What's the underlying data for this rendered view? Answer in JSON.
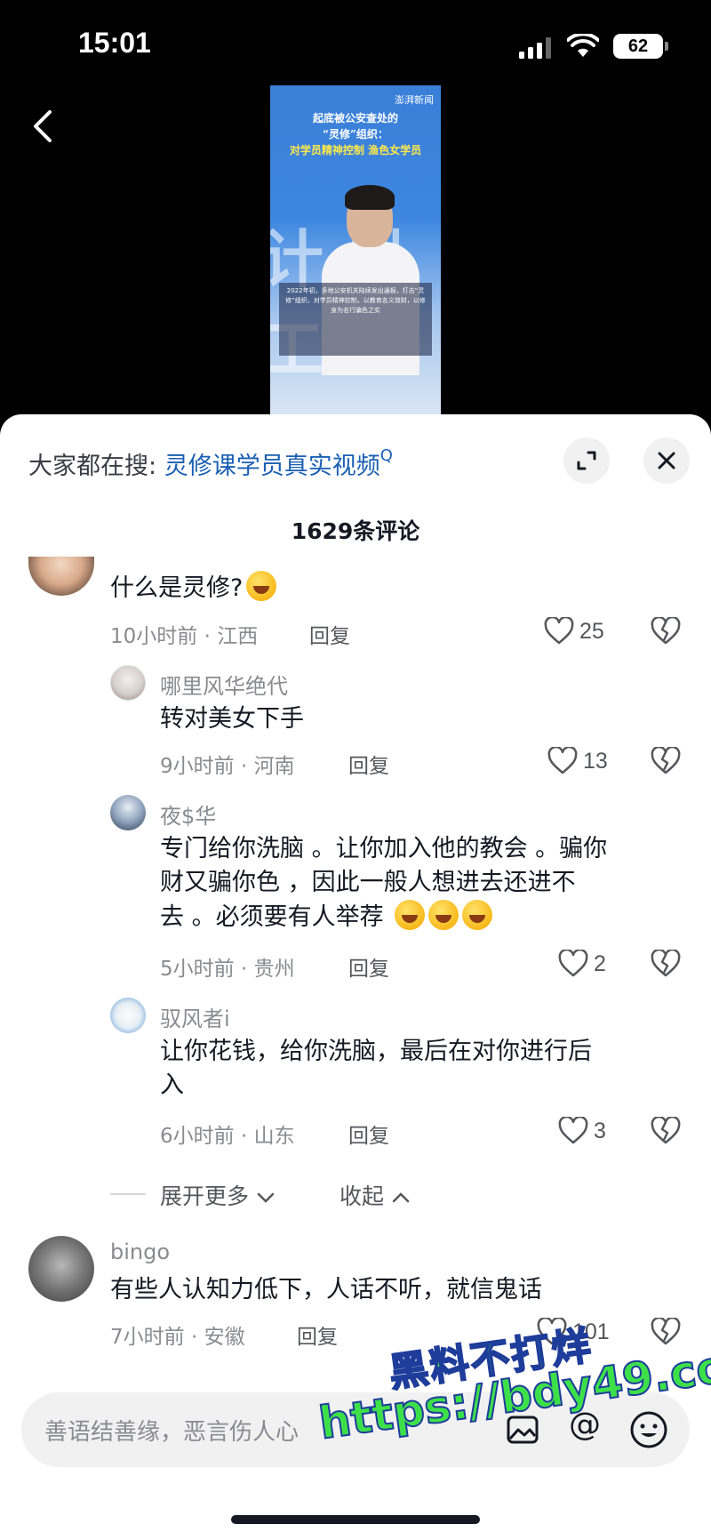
{
  "status_bar": {
    "time": "15:01",
    "battery": "62"
  },
  "video": {
    "brand": "澎湃新闻",
    "title_line1": "起底被公安查处的",
    "title_line2": "“灵修”组织：",
    "title_line3": "对学员精神控制 渔色女学员",
    "background_text": "计划工",
    "caption": "2022年初，多地公安机关陆续发出通报，打击“灵修”组织，对学员精神控制，以教育名义敛财，以修身为名行骗色之实"
  },
  "sheet": {
    "search_prefix": "大家都在搜:",
    "search_term": "灵修课学员真实视频",
    "search_q": "Q",
    "comment_count": "1629条评论"
  },
  "comments": [
    {
      "name": "",
      "text": "什么是灵修?",
      "time": "10小时前 · 江西",
      "reply": "回复",
      "likes": "25"
    },
    {
      "name": "哪里风华绝代",
      "text": "转对美女下手",
      "time": "9小时前 · 河南",
      "reply": "回复",
      "likes": "13"
    },
    {
      "name": "夜$华",
      "text_line1": "专门给你洗脑 。让你加入他的教会 。骗你",
      "text_line2": "财又骗你色 ，因此一般人想进去还进不",
      "text_line3": "去 。必须要有人举荐",
      "time": "5小时前 · 贵州",
      "reply": "回复",
      "likes": "2"
    },
    {
      "name": "驭风者i",
      "text_line1": "让你花钱，给你洗脑，最后在对你进行后",
      "text_line2": "入",
      "time": "6小时前 · 山东",
      "reply": "回复",
      "likes": "3"
    },
    {
      "name": "bingo",
      "text": "有些人认知力低下，人话不听，就信鬼话",
      "time": "7小时前 · 安徽",
      "reply": "回复",
      "likes": "101"
    }
  ],
  "thread": {
    "expand_more": "展开更多",
    "collapse": "收起"
  },
  "input": {
    "placeholder": "善语结善缘，恶言伤人心",
    "at_symbol": "@"
  },
  "watermark": {
    "line1": "黑料不打烊",
    "line2": "https://bdy49.co"
  },
  "colors": {
    "accent_link": "#1a5fb4",
    "sheet_bg": "#ffffff",
    "secondary_text": "#8a8b91",
    "watermark_green": "#3ee04a"
  }
}
